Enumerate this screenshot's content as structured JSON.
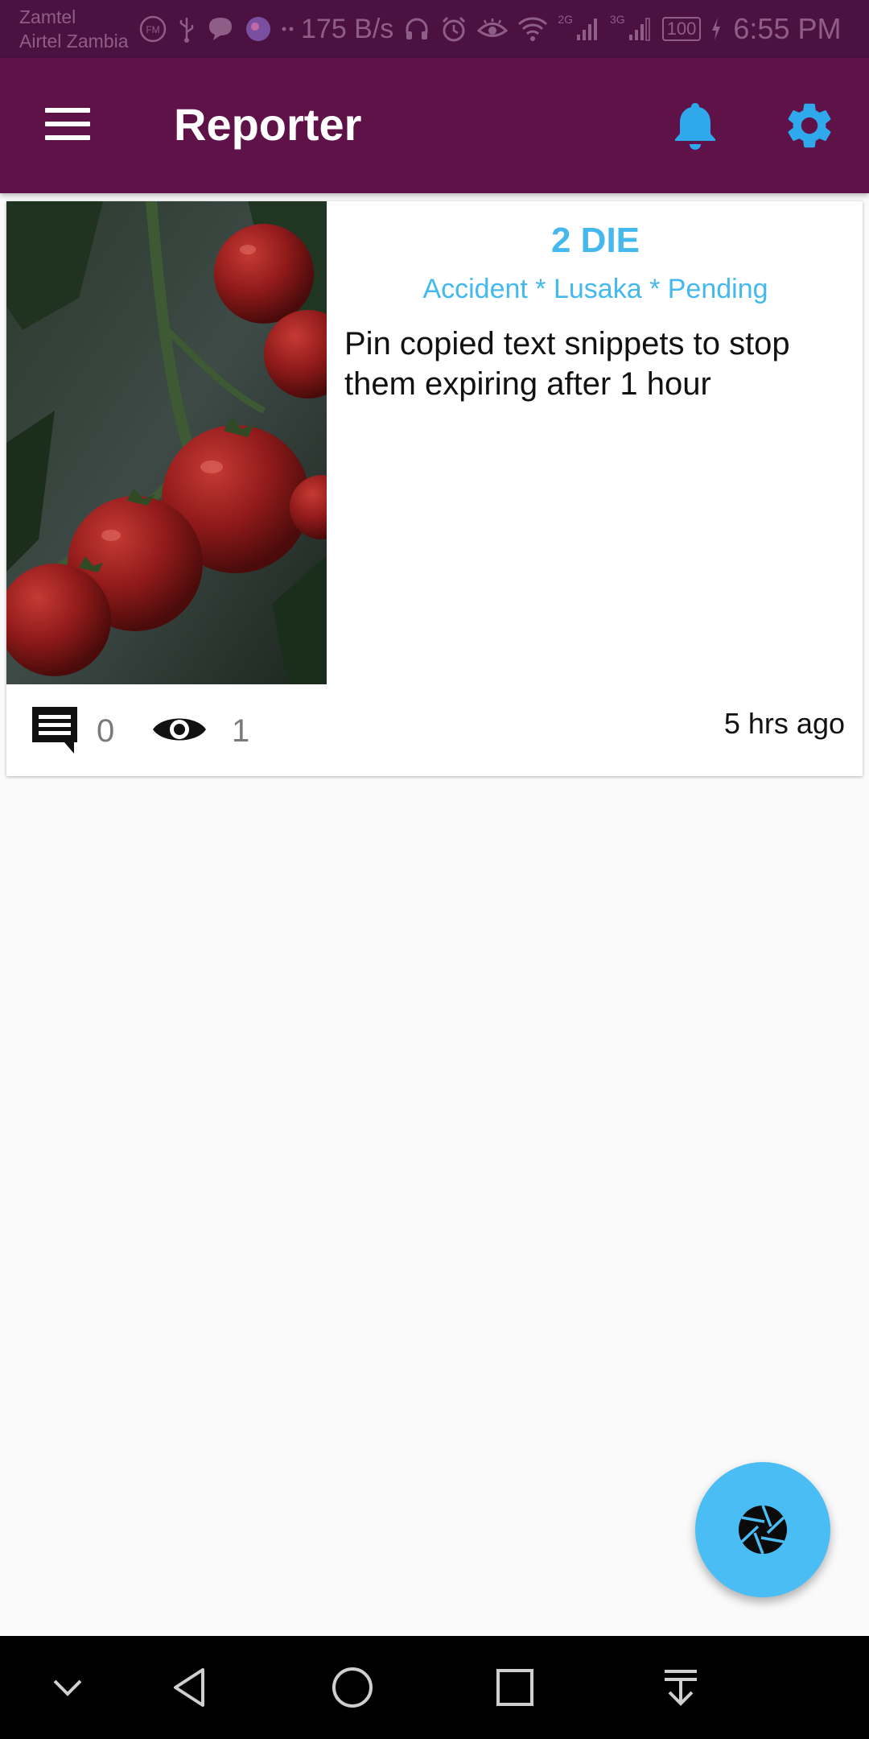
{
  "status_bar": {
    "carrier_1": "Zamtel",
    "carrier_2": "Airtel Zambia",
    "fm_label": "FM",
    "speed": "175 B/s",
    "net_2g": "2G",
    "net_3g": "3G",
    "battery": "100",
    "time": "6:55 PM"
  },
  "app_bar": {
    "title": "Reporter",
    "icons": [
      "menu-icon",
      "bell-icon",
      "gear-icon"
    ]
  },
  "report_card": {
    "title": "2 DIE",
    "meta": "Accident * Lusaka * Pending",
    "body": "Pin copied text snippets to stop them expiring after 1 hour",
    "comment_count": "0",
    "view_count": "1",
    "time_ago": "5 hrs ago"
  },
  "fab": {
    "icon": "camera-shutter-icon"
  },
  "nav_bar": {
    "icons": [
      "chevron-down-icon",
      "back-icon",
      "home-icon",
      "recents-icon",
      "notification-pull-icon"
    ]
  },
  "colors": {
    "status_bar_bg": "#4a1141",
    "app_bar_bg": "#5f1247",
    "accent": "#44b9ee",
    "fab_bg": "#4bbdf5",
    "background": "#fafafa"
  }
}
